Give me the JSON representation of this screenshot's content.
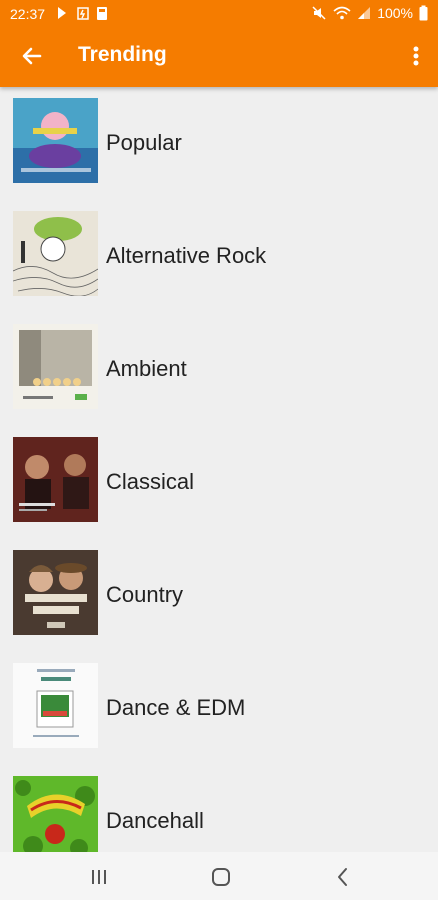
{
  "status_bar": {
    "time": "22:37",
    "battery": "100%"
  },
  "toolbar": {
    "title": "Trending"
  },
  "genres": [
    {
      "label": "Popular"
    },
    {
      "label": "Alternative Rock"
    },
    {
      "label": "Ambient"
    },
    {
      "label": "Classical"
    },
    {
      "label": "Country"
    },
    {
      "label": "Dance & EDM"
    },
    {
      "label": "Dancehall"
    }
  ],
  "colors": {
    "accent": "#f57c00",
    "background": "#efefef"
  },
  "icons": {
    "back": "arrow-back-icon",
    "menu": "more-vert-icon",
    "recents": "recents-icon",
    "home": "home-icon",
    "nav_back": "nav-back-icon"
  }
}
